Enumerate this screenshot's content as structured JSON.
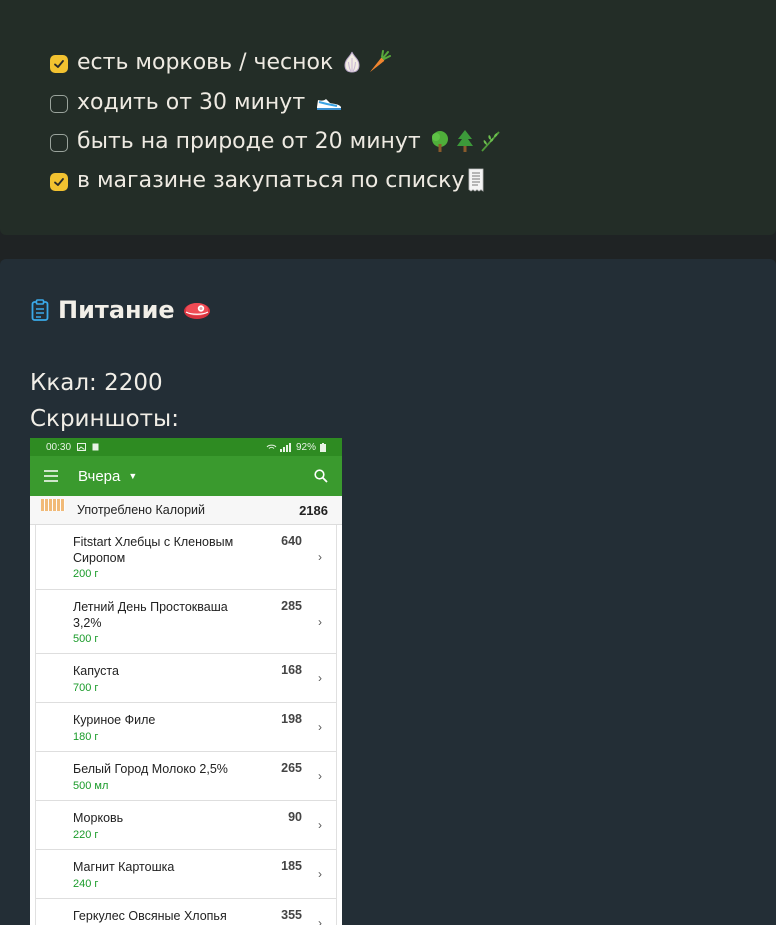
{
  "habits": [
    {
      "label": "есть морковь / чеснок",
      "checked": true,
      "emoji": [
        "garlic-icon",
        "carrot-icon"
      ]
    },
    {
      "label": "ходить от 30 минут",
      "checked": false,
      "emoji": [
        "sneaker-icon"
      ]
    },
    {
      "label": "быть на природе от 20 минут",
      "checked": false,
      "emoji": [
        "tree-icon",
        "evergreen-icon",
        "herb-icon"
      ]
    },
    {
      "label": "в магазине закупаться по списку",
      "checked": true,
      "emoji": [
        "receipt-icon"
      ]
    }
  ],
  "food": {
    "title": "Питание",
    "kcal_text": "Ккал: 2200",
    "screens_text": "Скриншоты:"
  },
  "phone": {
    "time": "00:30",
    "battery": "92%",
    "appbar_title": "Вчера",
    "summary_label": "Употреблено Калорий",
    "summary_value": "2186",
    "rows": [
      {
        "name": "Fitstart Хлебцы с Кленовым Сиропом",
        "amount": "200 г",
        "kcal": "640",
        "lines": 2
      },
      {
        "name": "Летний День Простокваша 3,2%",
        "amount": "500 г",
        "kcal": "285",
        "lines": 2
      },
      {
        "name": "Капуста",
        "amount": "700 г",
        "kcal": "168",
        "lines": 1
      },
      {
        "name": "Куриное Филе",
        "amount": "180 г",
        "kcal": "198",
        "lines": 1
      },
      {
        "name": "Белый Город Молоко 2,5%",
        "amount": "500 мл",
        "kcal": "265",
        "lines": 1
      },
      {
        "name": "Морковь",
        "amount": "220 г",
        "kcal": "90",
        "lines": 1
      },
      {
        "name": "Магнит Картошка",
        "amount": "240 г",
        "kcal": "185",
        "lines": 1
      },
      {
        "name": "Геркулес Овсяные Хлопья",
        "amount": "",
        "kcal": "355",
        "lines": 1
      }
    ]
  },
  "colors": {
    "checkbox_on": "#f2c230",
    "app_green": "#3a9a2e",
    "amount_green": "#1a9b2a"
  }
}
